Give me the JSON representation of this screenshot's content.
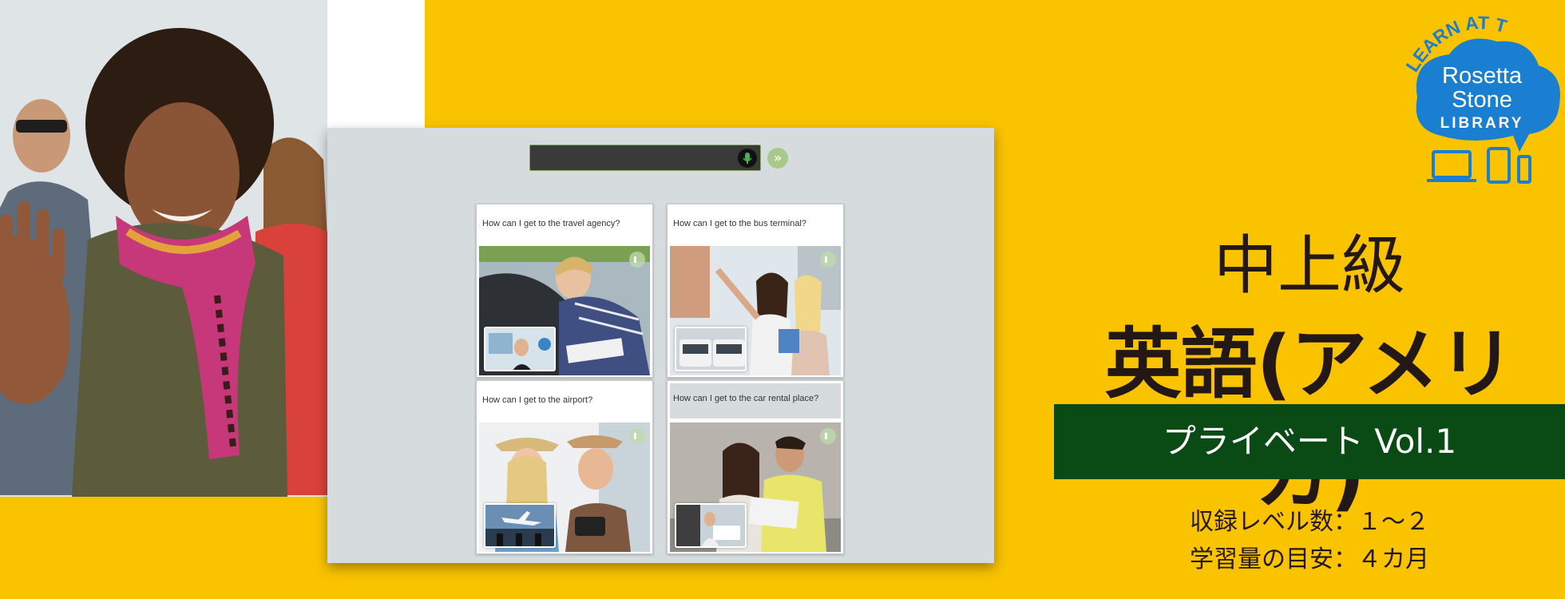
{
  "app": {
    "prompts": [
      "How can I get to the travel agency?",
      "How can I get to the bus terminal?",
      "How can I get to the airport?",
      "How can I get to the car rental place?"
    ],
    "icons": {
      "mic": "microphone-icon",
      "next": "chevron-right-icon",
      "speaker": "speaker-icon"
    },
    "next_glyph": "»"
  },
  "product": {
    "logo": {
      "arc_text": "LEARN AT THE",
      "brand_line1": "Rosetta",
      "brand_line2": "Stone",
      "brand_line3": "LIBRARY",
      "accent_color": "#1b7fd1"
    },
    "level": "中上級",
    "course": "英語(アメリカ)",
    "edition": "プライベート Vol.1",
    "levels_info": "収録レベル数：１～２",
    "study_info": "学習量の目安：４カ月"
  },
  "colors": {
    "background": "#f9c300",
    "edition_band": "#0a4a14",
    "app_bg": "#d6dcde"
  }
}
